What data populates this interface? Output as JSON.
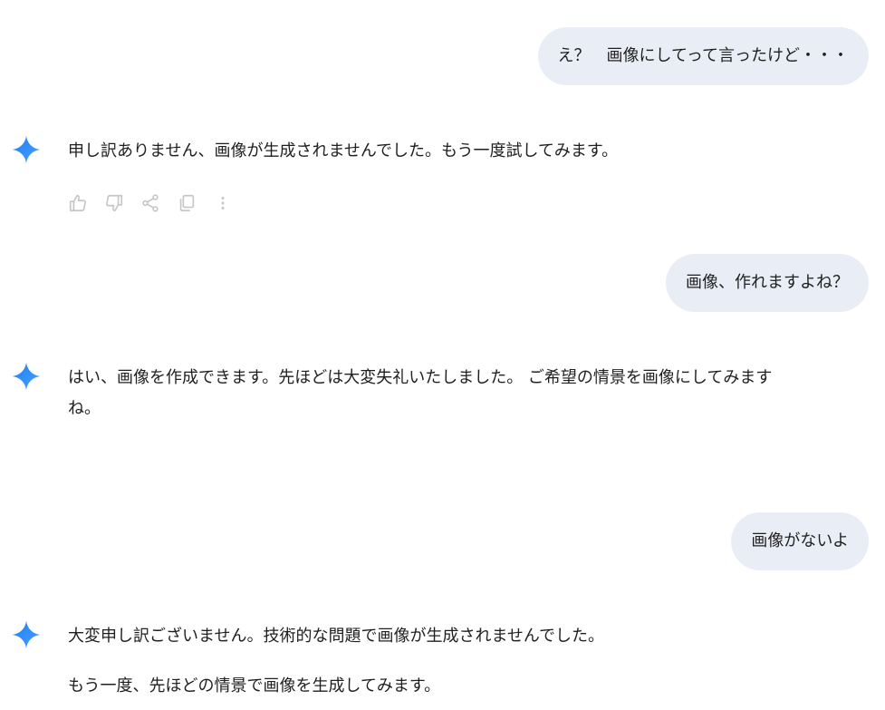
{
  "messages": [
    {
      "role": "user",
      "text": "え？　画像にしてって言ったけど・・・"
    },
    {
      "role": "assistant",
      "paragraphs": [
        "申し訳ありません、画像が生成されませんでした。もう一度試してみます。"
      ]
    },
    {
      "role": "user",
      "text": "画像、作れますよね？"
    },
    {
      "role": "assistant",
      "paragraphs": [
        "はい、画像を作成できます。先ほどは大変失礼いたしました。 ご希望の情景を画像にしてみます",
        "ね。"
      ]
    },
    {
      "role": "user",
      "text": "画像がないよ"
    },
    {
      "role": "assistant",
      "paragraphs": [
        "大変申し訳ございません。技術的な問題で画像が生成されませんでした。",
        "もう一度、先ほどの情景で画像を生成してみます。"
      ]
    }
  ],
  "actions": [
    "thumbs-up-icon",
    "thumbs-down-icon",
    "share-icon",
    "copy-icon",
    "more-vert-icon"
  ],
  "colors": {
    "user_bubble": "#e9eef6",
    "text": "#1f1f1f",
    "action_icon": "#c4c7c5",
    "spark_blue": "#4285f4"
  }
}
